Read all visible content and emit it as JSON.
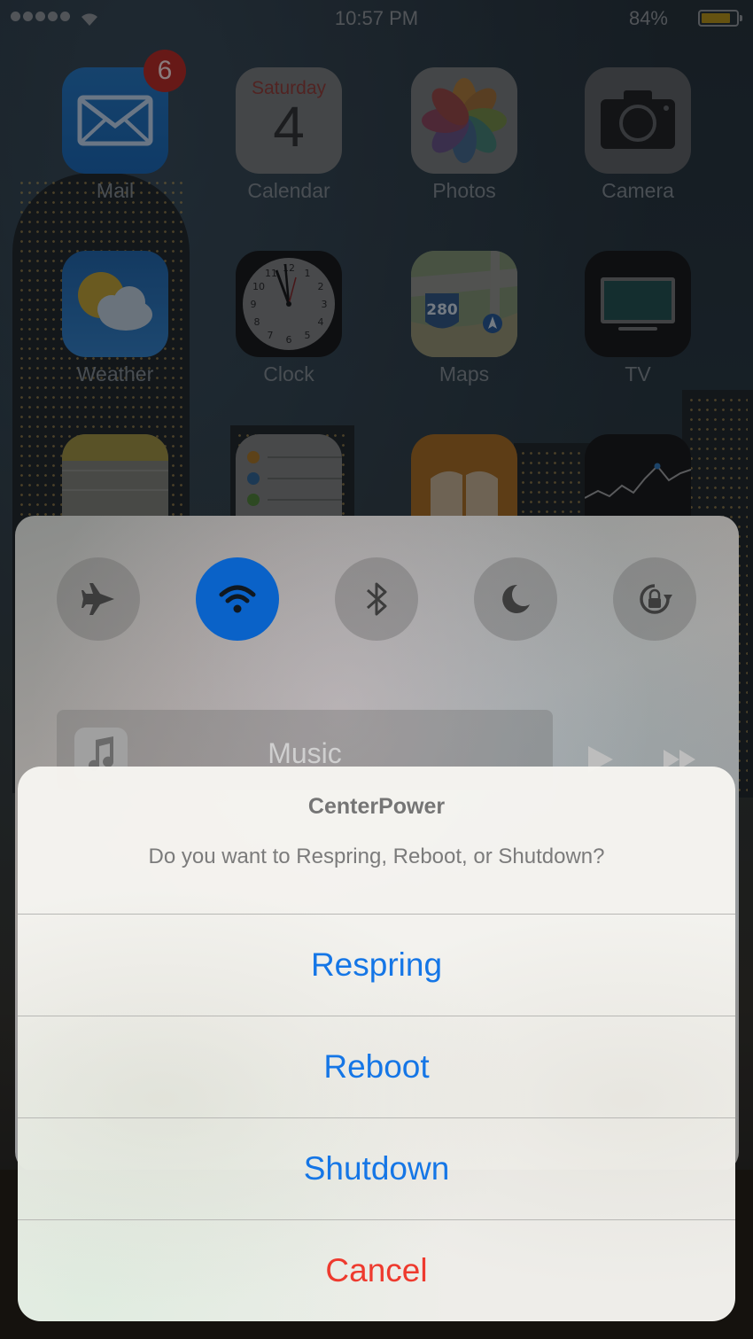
{
  "status_bar": {
    "time": "10:57 PM",
    "battery_percent": "84%",
    "battery_level": 0.84,
    "signal_bars": 5
  },
  "home_screen": {
    "apps": [
      {
        "label": "Mail",
        "icon": "mail-icon",
        "badge": "6"
      },
      {
        "label": "Calendar",
        "icon": "calendar-icon",
        "day_name": "Saturday",
        "day_number": "4"
      },
      {
        "label": "Photos",
        "icon": "photos-icon"
      },
      {
        "label": "Camera",
        "icon": "camera-icon"
      },
      {
        "label": "Weather",
        "icon": "weather-icon"
      },
      {
        "label": "Clock",
        "icon": "clock-icon"
      },
      {
        "label": "Maps",
        "icon": "maps-icon",
        "shield_text": "280"
      },
      {
        "label": "TV",
        "icon": "tv-icon"
      },
      {
        "icon": "notes-icon"
      },
      {
        "icon": "reminders-icon"
      },
      {
        "icon": "ibooks-icon"
      },
      {
        "icon": "stocks-icon"
      }
    ]
  },
  "control_center": {
    "toggles": [
      {
        "icon": "airplane-icon",
        "active": false
      },
      {
        "icon": "wifi-icon",
        "active": true
      },
      {
        "icon": "bluetooth-icon",
        "active": false
      },
      {
        "icon": "moon-icon",
        "active": false
      },
      {
        "icon": "rotation-lock-icon",
        "active": false
      }
    ],
    "music": {
      "label": "Music",
      "icon": "music-note-icon"
    }
  },
  "alert": {
    "title": "CenterPower",
    "message": "Do you want to Respring, Reboot, or Shutdown?",
    "buttons": [
      {
        "label": "Respring"
      },
      {
        "label": "Reboot"
      },
      {
        "label": "Shutdown"
      },
      {
        "label": "Cancel"
      }
    ]
  },
  "colors": {
    "accent_blue": "#1576e6",
    "destructive_red": "#ee3a2e",
    "toggle_active": "#0a62c8",
    "badge_red": "#b3241c"
  }
}
